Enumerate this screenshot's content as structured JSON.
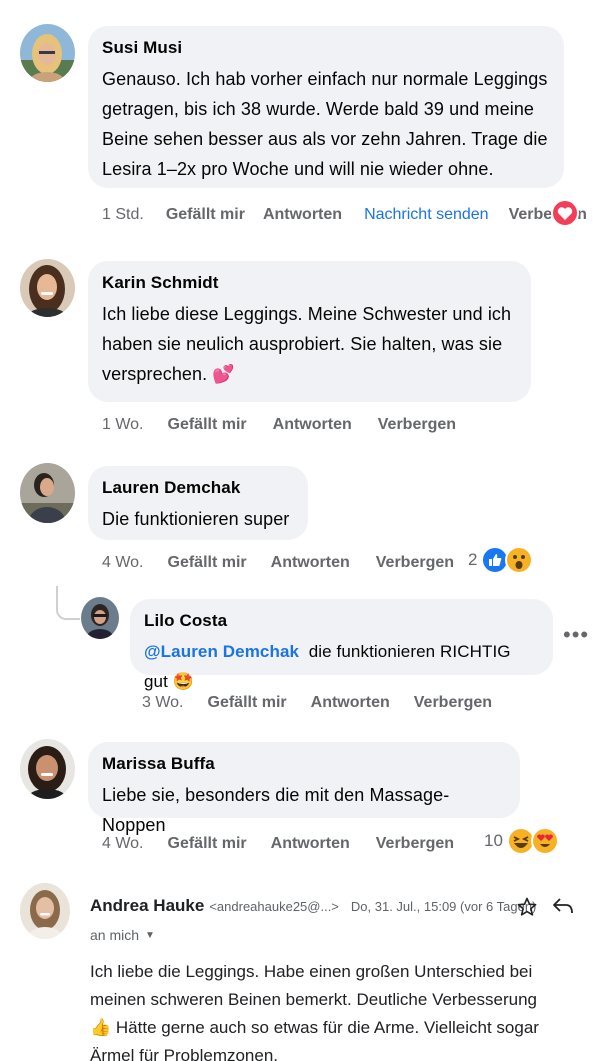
{
  "colors": {
    "bubble": "#f0f2f5",
    "link": "#1b74e4",
    "meta": "#65676b",
    "love": "#f33e58",
    "like": "#1877f2",
    "haha": "#f7b125"
  },
  "comments": [
    {
      "author": "Susi Musi",
      "text": "Genauso. Ich hab vorher einfach nur normale Leggings getragen, bis ich 38 wurde. Werde bald 39 und meine Beine sehen besser aus als vor zehn Jahren. Trage die Lesira 1–2x pro Woche und will nie wieder ohne.",
      "time": "1 Std.",
      "like": "Gefällt mir",
      "reply": "Antworten",
      "message": "Nachricht senden",
      "hide": "Verbergen",
      "reaction_icon": "heart-icon"
    },
    {
      "author": "Karin Schmidt",
      "text": "Ich liebe diese Leggings. Meine Schwester und ich haben sie neulich ausprobiert. Sie halten, was sie versprechen.",
      "emoji": "💕",
      "time": "1 Wo.",
      "like": "Gefällt mir",
      "reply": "Antworten",
      "hide": "Verbergen"
    },
    {
      "author": "Lauren Demchak",
      "text": "Die funktionieren super",
      "time": "4 Wo.",
      "like": "Gefällt mir",
      "reply": "Antworten",
      "hide": "Verbergen",
      "reaction_count": "2",
      "reaction_icons": [
        "like-icon",
        "wow-icon"
      ],
      "replies": [
        {
          "author": "Lilo Costa",
          "mention": "@Lauren Demchak",
          "text": "die funktionieren RICHTIG gut",
          "emoji": "🤩",
          "time": "3 Wo.",
          "like": "Gefällt mir",
          "reply": "Antworten",
          "hide": "Verbergen"
        }
      ]
    },
    {
      "author": "Marissa Buffa",
      "text": "Liebe sie, besonders die mit den Massage-Noppen",
      "time": "4 Wo.",
      "like": "Gefällt mir",
      "reply": "Antworten",
      "hide": "Verbergen",
      "reaction_count": "10",
      "reaction_icons": [
        "haha-icon",
        "heart-eyes-icon"
      ]
    }
  ],
  "email": {
    "sender_name": "Andrea Hauke",
    "sender_address": "<andreahauke25@...>",
    "date": "Do, 31. Jul., 15:09 (vor 6 Tagen)",
    "to": "an mich",
    "body_line1": "Ich liebe die Leggings. Habe einen großen Unterschied bei meinen schweren Beinen bemerkt. Deutliche Verbesserung",
    "body_emoji": "👍",
    "body_line2": "Hätte gerne auch so etwas für die Arme. Vielleicht sogar Ärmel für Problemzonen."
  }
}
